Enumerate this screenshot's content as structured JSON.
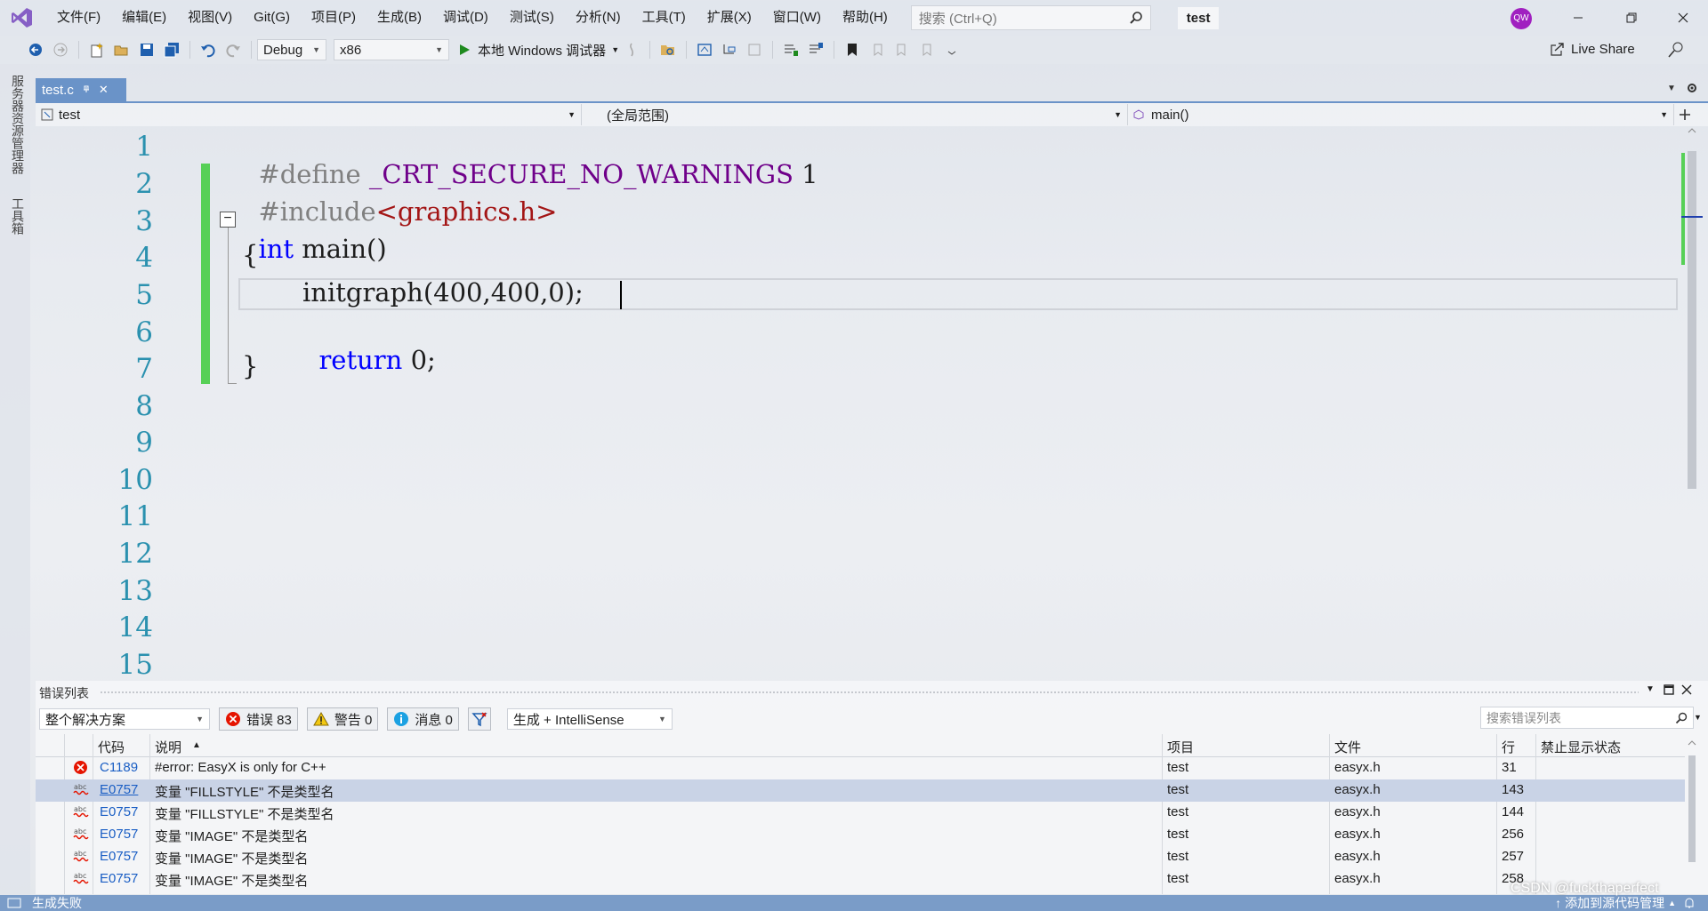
{
  "titlebar": {
    "menus": [
      "文件(F)",
      "编辑(E)",
      "视图(V)",
      "Git(G)",
      "项目(P)",
      "生成(B)",
      "调试(D)",
      "测试(S)",
      "分析(N)",
      "工具(T)",
      "扩展(X)",
      "窗口(W)",
      "帮助(H)"
    ],
    "search_placeholder": "搜索 (Ctrl+Q)",
    "solution_name": "test",
    "user_initials": "QW"
  },
  "toolbar": {
    "config": "Debug",
    "platform": "x86",
    "run_label": "本地 Windows 调试器",
    "live_share": "Live Share"
  },
  "left_strip": {
    "server_explorer": "服务器资源管理器",
    "toolbox": "工具箱"
  },
  "tab": {
    "filename": "test.c",
    "pin": "ㅁ",
    "close": "✕"
  },
  "navbar": {
    "project": "test",
    "scope": "(全局范围)",
    "member": "main()"
  },
  "editor": {
    "line_numbers": [
      "1",
      "2",
      "3",
      "4",
      "5",
      "6",
      "7",
      "8",
      "9",
      "10",
      "11",
      "12",
      "13",
      "14",
      "15"
    ],
    "code": {
      "l1_directive": "#define",
      "l1_macro": "_CRT_SECURE_NO_WARNINGS",
      "l1_value": "1",
      "l2_directive": "#include",
      "l2_header": "<graphics.h>",
      "l3_type": "int",
      "l3_rest": "main()",
      "l4": "{",
      "l5": "initgraph(400,400,0);",
      "l6_kw": "return",
      "l6_rest": "0;",
      "l7": "}"
    }
  },
  "error_list": {
    "title": "错误列表",
    "scope": "整个解决方案",
    "errors_label": "错误 83",
    "warnings_label": "警告 0",
    "messages_label": "消息 0",
    "build_filter": "生成 + IntelliSense",
    "search_placeholder": "搜索错误列表",
    "columns": {
      "code": "代码",
      "desc": "说明",
      "project": "项目",
      "file": "文件",
      "line": "行",
      "suppress": "禁止显示状态"
    },
    "rows": [
      {
        "code": "C1189",
        "desc": "#error:  EasyX is only for C++",
        "project": "test",
        "file": "easyx.h",
        "line": "31"
      },
      {
        "code": "E0757",
        "desc": "变量 \"FILLSTYLE\" 不是类型名",
        "project": "test",
        "file": "easyx.h",
        "line": "143"
      },
      {
        "code": "E0757",
        "desc": "变量 \"FILLSTYLE\" 不是类型名",
        "project": "test",
        "file": "easyx.h",
        "line": "144"
      },
      {
        "code": "E0757",
        "desc": "变量 \"IMAGE\" 不是类型名",
        "project": "test",
        "file": "easyx.h",
        "line": "256"
      },
      {
        "code": "E0757",
        "desc": "变量 \"IMAGE\" 不是类型名",
        "project": "test",
        "file": "easyx.h",
        "line": "257"
      },
      {
        "code": "E0757",
        "desc": "变量 \"IMAGE\" 不是类型名",
        "project": "test",
        "file": "easyx.h",
        "line": "258"
      }
    ]
  },
  "status": {
    "build_status": "生成失败",
    "source_control": "添加到源代码管理",
    "watermark": "CSDN @fuckthaperfect"
  },
  "colors": {
    "accent": "#6a93c8",
    "keyword": "#0000ff",
    "macro": "#6f008a",
    "string": "#a31515",
    "line_number": "#2b91af",
    "change_bar": "#57d057",
    "status_bar": "#7a9cc8"
  }
}
